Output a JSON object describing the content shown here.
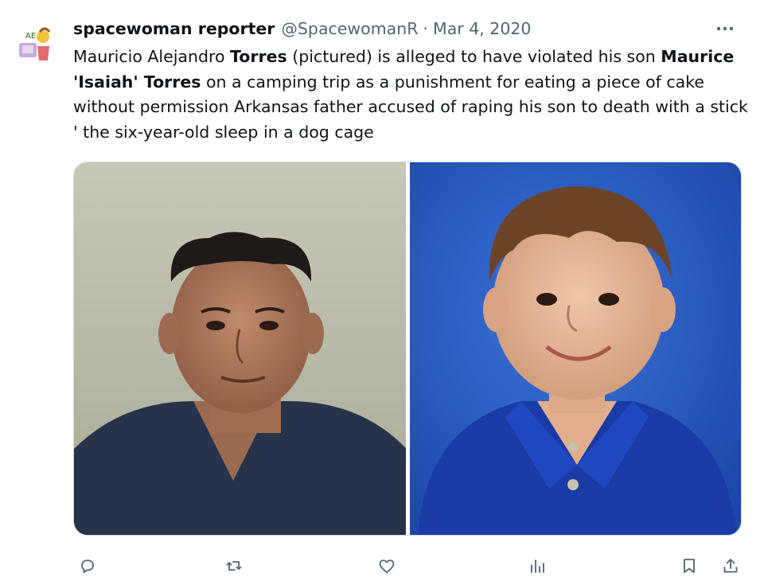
{
  "tweet": {
    "author_name": "spacewoman reporter",
    "handle": "@SpacewomanR",
    "separator": "·",
    "date": "Mar 4, 2020",
    "text_parts": [
      "Mauricio Alejandro ",
      "Torres",
      " (pictured) is alleged to have violated his son ",
      "Maurice 'Isaiah' Torres",
      " on a camping trip as a punishment for eating a piece of cake without permission Arkansas father accused of raping his son to death with a stick ' the six-year-old sleep in a dog cage"
    ]
  },
  "media": {
    "count": 2,
    "left_photo": "mugshot-photo",
    "right_photo": "child-portrait-photo"
  },
  "icons": {
    "more": "more-dots-icon",
    "reply": "reply-icon",
    "retweet": "retweet-icon",
    "like": "like-icon",
    "views": "views-icon",
    "bookmark": "bookmark-icon",
    "share": "share-icon"
  },
  "colors": {
    "text": "#0f1419",
    "secondary": "#536471",
    "border": "#cfd9de"
  }
}
